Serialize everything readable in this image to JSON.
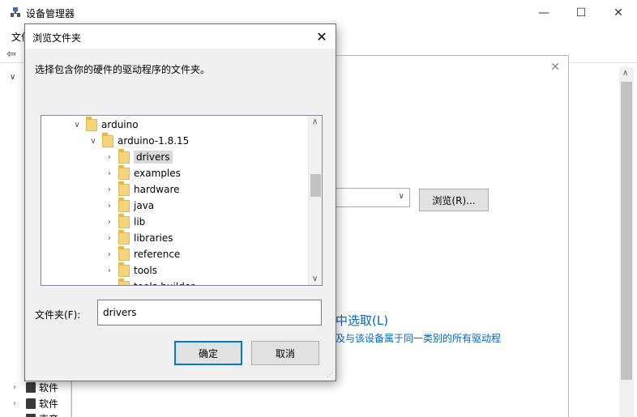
{
  "main_window": {
    "title": "设备管理器",
    "menu_first": "文件",
    "controls": {
      "minimize": "—",
      "maximize": "☐",
      "close": "✕"
    },
    "tree": {
      "rows": [
        {
          "label": "软件"
        },
        {
          "label": "软件"
        },
        {
          "label": "声音"
        }
      ]
    }
  },
  "wizard": {
    "browse_button": "浏览(R)...",
    "pick_link": "中选取(L)",
    "pick_desc": "及与该设备属于同一类别的所有驱动程"
  },
  "dialog": {
    "title": "浏览文件夹",
    "prompt": "选择包含你的硬件的驱动程序的文件夹。",
    "tree": [
      {
        "label": "arduino",
        "twisty": "expanded",
        "depth": 0
      },
      {
        "label": "arduino-1.8.15",
        "twisty": "expanded",
        "depth": 1
      },
      {
        "label": "drivers",
        "twisty": "collapsed",
        "depth": 2,
        "selected": true
      },
      {
        "label": "examples",
        "twisty": "collapsed",
        "depth": 2
      },
      {
        "label": "hardware",
        "twisty": "collapsed",
        "depth": 2
      },
      {
        "label": "java",
        "twisty": "collapsed",
        "depth": 2
      },
      {
        "label": "lib",
        "twisty": "collapsed",
        "depth": 2
      },
      {
        "label": "libraries",
        "twisty": "collapsed",
        "depth": 2
      },
      {
        "label": "reference",
        "twisty": "collapsed",
        "depth": 2
      },
      {
        "label": "tools",
        "twisty": "collapsed",
        "depth": 2
      },
      {
        "label": "tools-builder",
        "twisty": "collapsed",
        "depth": 2
      }
    ],
    "folder_label": "文件夹(F):",
    "folder_value": "drivers",
    "ok_label": "确定",
    "cancel_label": "取消"
  },
  "colors": {
    "accent": "#0078d7",
    "link": "#0066cc",
    "folder": "#f6d57a"
  }
}
